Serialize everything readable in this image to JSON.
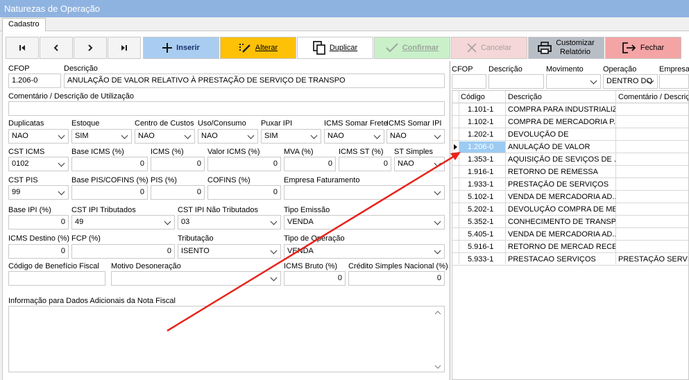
{
  "window": {
    "title": "Naturezas de Operação"
  },
  "tabs": [
    {
      "label": "Cadastro"
    }
  ],
  "toolbar": {
    "inserir": "Inserir",
    "alterar": "Alterar",
    "duplicar": "Duplicar",
    "confirmar": "Confirmar",
    "cancelar": "Cancelar",
    "customizar_line1": "Customizar",
    "customizar_line2": "Relatório",
    "fechar": "Fechar",
    "colors": {
      "inserir": "#a9cdf0",
      "alterar": "#ffc107",
      "confirmar": "#c9f0c9",
      "cancelar": "#f5d7d7",
      "customizar": "#b8bec6",
      "fechar": "#f4a4a4"
    }
  },
  "form": {
    "cfop": {
      "label": "CFOP",
      "value": "1.206-0"
    },
    "descricao": {
      "label": "Descrição",
      "value": "ANULAÇÃO DE VALOR RELATIVO À PRESTAÇÃO DE SERVIÇO DE TRANSPO"
    },
    "comentario": {
      "label": "Comentário / Descrição de Utilização",
      "value": ""
    },
    "duplicatas": {
      "label": "Duplicatas",
      "value": "NAO"
    },
    "estoque": {
      "label": "Estoque",
      "value": "SIM"
    },
    "centro_custos": {
      "label": "Centro de Custos",
      "value": "NAO"
    },
    "uso_consumo": {
      "label": "Uso/Consumo",
      "value": "NAO"
    },
    "puxar_ipi": {
      "label": "Puxar IPI",
      "value": "SIM"
    },
    "icms_somar_frete": {
      "label": "ICMS Somar Frete",
      "value": "NAO"
    },
    "icms_somar_ipi": {
      "label": "ICMS Somar IPI",
      "value": "NAO"
    },
    "cst_icms": {
      "label": "CST ICMS",
      "value": "0102"
    },
    "base_icms": {
      "label": "Base ICMS (%)",
      "value": "0"
    },
    "icms": {
      "label": "ICMS (%)",
      "value": "0"
    },
    "valor_icms": {
      "label": "Valor ICMS (%)",
      "value": "0"
    },
    "mva": {
      "label": "MVA (%)",
      "value": "0"
    },
    "icms_st": {
      "label": "ICMS ST (%)",
      "value": "0"
    },
    "st_simples": {
      "label": "ST Simples",
      "value": "NAO"
    },
    "cst_pis": {
      "label": "CST PIS",
      "value": "99"
    },
    "base_pis_cofins": {
      "label": "Base PIS/COFINS (%)",
      "value": "0"
    },
    "pis": {
      "label": "PIS (%)",
      "value": "0"
    },
    "cofins": {
      "label": "COFINS (%)",
      "value": "0"
    },
    "empresa_faturamento": {
      "label": "Empresa Faturamento",
      "value": ""
    },
    "base_ipi": {
      "label": "Base IPI (%)",
      "value": "0"
    },
    "cst_ipi_trib": {
      "label": "CST IPI Tributados",
      "value": "49"
    },
    "cst_ipi_nao_trib": {
      "label": "CST IPI Não Tributados",
      "value": "03"
    },
    "tipo_emissao": {
      "label": "Tipo Emissão",
      "value": "VENDA"
    },
    "icms_destino": {
      "label": "ICMS Destino (%)",
      "value": "0"
    },
    "fcp": {
      "label": "FCP (%)",
      "value": "0"
    },
    "tributacao": {
      "label": "Tributação",
      "value": "ISENTO"
    },
    "tipo_operacao": {
      "label": "Tipo de Operação",
      "value": "VENDA"
    },
    "cod_beneficio": {
      "label": "Código de Benefício Fiscal",
      "value": ""
    },
    "motivo_desoneracao": {
      "label": "Motivo Desoneração",
      "value": ""
    },
    "icms_bruto": {
      "label": "ICMS Bruto (%)",
      "value": "0"
    },
    "credito_simples": {
      "label": "Crédito Simples Nacional (%)",
      "value": "0"
    },
    "info_adicionais": {
      "label": "Informação para Dados Adicionais da Nota Fiscal",
      "value": ""
    }
  },
  "filters": {
    "cfop": {
      "label": "CFOP",
      "value": ""
    },
    "descricao": {
      "label": "Descrição",
      "value": ""
    },
    "movimento": {
      "label": "Movimento",
      "value": ""
    },
    "operacao": {
      "label": "Operação",
      "value": "DENTRO DO"
    },
    "empresa": {
      "label": "Empresa",
      "value": ""
    }
  },
  "grid": {
    "headers": [
      "Código",
      "Descrição",
      "Comentário / Descriçã"
    ],
    "rows": [
      {
        "codigo": "1.101-1",
        "descricao": "COMPRA PARA INDUSTRIALIZ...",
        "comentario": ""
      },
      {
        "codigo": "1.102-1",
        "descricao": "COMPRA DE MERCADORIA P...",
        "comentario": ""
      },
      {
        "codigo": "1.202-1",
        "descricao": "DEVOLUÇÃO DE",
        "comentario": ""
      },
      {
        "codigo": "1.206-0",
        "descricao": "ANULAÇÃO DE VALOR",
        "comentario": "",
        "selected": true
      },
      {
        "codigo": "1.353-1",
        "descricao": "AQUISIÇÃO DE SEVIÇOS DE ...",
        "comentario": ""
      },
      {
        "codigo": "1.916-1",
        "descricao": "RETORNO DE REMESSA",
        "comentario": ""
      },
      {
        "codigo": "1.933-1",
        "descricao": "PRESTAÇÃO DE SERVIÇOS",
        "comentario": ""
      },
      {
        "codigo": "5.102-1",
        "descricao": "VENDA DE MERCADORIA AD...",
        "comentario": ""
      },
      {
        "codigo": "5.202-1",
        "descricao": "DEVOLUÇÃO COMPRA DE ME...",
        "comentario": ""
      },
      {
        "codigo": "5.352-1",
        "descricao": "CONHECIMENTO DE TRANSP...",
        "comentario": ""
      },
      {
        "codigo": "5.405-1",
        "descricao": "VENDA DE MERCADORIA AD...",
        "comentario": ""
      },
      {
        "codigo": "5.916-1",
        "descricao": "RETORNO DE MERCAD RECE...",
        "comentario": ""
      },
      {
        "codigo": "5.933-1",
        "descricao": "PRESTACAO SERVIÇOS",
        "comentario": "PRESTAÇÃO SERVIÇO"
      }
    ],
    "selected_color": "#cfe6fb"
  },
  "annotation": {
    "arrow_color": "#e8231a"
  }
}
